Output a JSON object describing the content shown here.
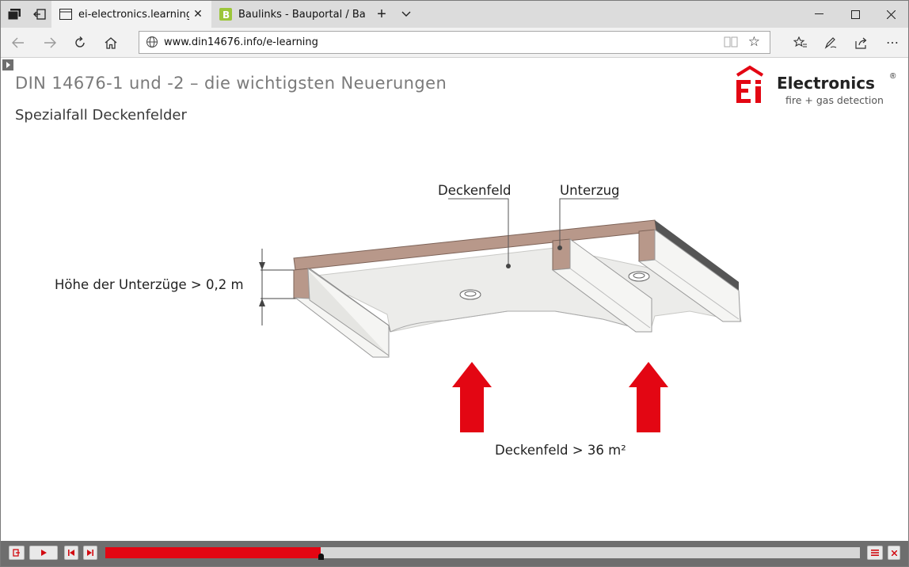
{
  "browser": {
    "tabs": [
      {
        "label": "ei-electronics.learningsy",
        "favicon": "page-icon",
        "active": true
      },
      {
        "label": "Baulinks - Bauportal / Baum",
        "favicon": "baulinks-b-icon",
        "active": false
      }
    ],
    "url": "www.din14676.info/e-learning"
  },
  "slide": {
    "title": "DIN 14676-1 und -2 – die wichtigsten Neuerungen",
    "subtitle": "Spezialfall Deckenfelder",
    "logo": {
      "brand": "Electronics",
      "registered": "®",
      "tagline": "fire + gas detection"
    },
    "labels": {
      "deckenfeld": "Deckenfeld",
      "unterzug": "Unterzug",
      "hoehe": "Höhe der Unterzüge > 0,2 m",
      "flaeche": "Deckenfeld > 36 m²"
    }
  },
  "player": {
    "progress": 0.285,
    "buttons": [
      "exit",
      "play",
      "previous",
      "next",
      "toc",
      "close"
    ]
  },
  "colors": {
    "accent": "#e30613",
    "beam": "#b8988a",
    "ceiling": "#ececea"
  }
}
